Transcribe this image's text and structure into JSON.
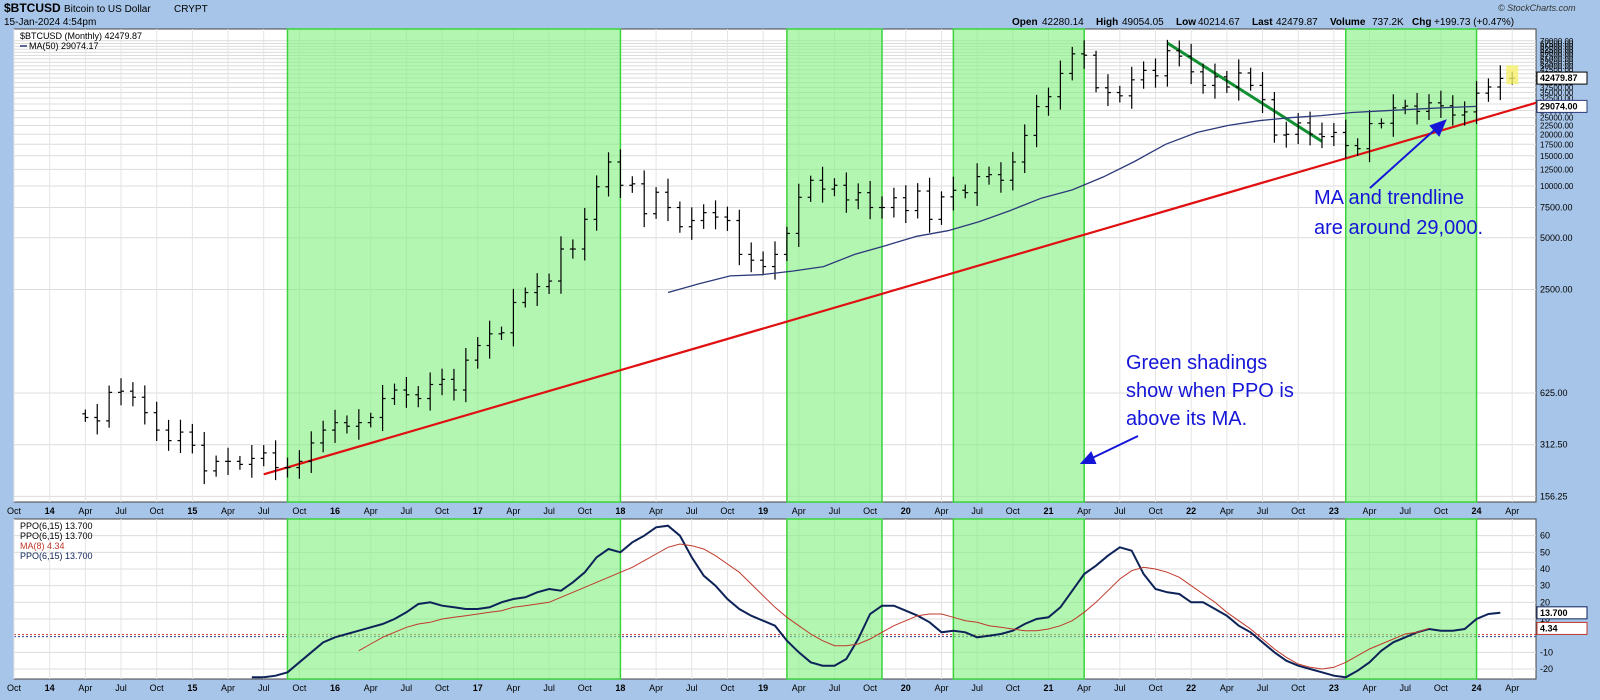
{
  "header": {
    "symbol": "$BTCUSD",
    "name": "Bitcoin to US Dollar",
    "exchange": "CRYPT",
    "date": "15-Jan-2024 4:54pm",
    "open_label": "Open",
    "open": "42280.14",
    "high_label": "High",
    "high": "49054.05",
    "low_label": "Low",
    "low": "40214.67",
    "last_label": "Last",
    "last": "42479.87",
    "volume_label": "Volume",
    "volume": "737.2K",
    "chg_label": "Chg",
    "chg": "+199.73 (+0.47%)",
    "brand": "© StockCharts.com"
  },
  "legend": {
    "price": "$BTCUSD (Monthly) 42479.87",
    "ma": "MA(50) 29074.17",
    "ppo_title": "PPO(6,15) 13.700",
    "ppo_line": "PPO(6,15) 13.700",
    "ppo_ma": "MA(8) 4.34",
    "ppo_line2": "PPO(6,15) 13.700"
  },
  "colors": {
    "price": "#000000",
    "ma50": "#2c3a7a",
    "ppo": "#0d2358",
    "ppo_ma": "#c0392b",
    "trendline": "#e01010",
    "downtrend": "#109030",
    "shading": "#7ff07f",
    "annotation": "#1515d8"
  },
  "annotations": {
    "ma_note": [
      "MA and trendline",
      "are around 29,000."
    ],
    "shade_note": [
      "Green shadings",
      "show when PPO is",
      "above its MA."
    ]
  },
  "chart_data": [
    {
      "type": "ohlc",
      "title": "$BTCUSD (Monthly)",
      "y_scale": "log",
      "ylim": [
        145,
        82000
      ],
      "y_ticks": [
        156.25,
        312.5,
        625,
        2500,
        5000,
        7500,
        10000,
        12500,
        15000,
        17500,
        20000,
        22500,
        25000,
        27500,
        30000,
        32500,
        35000,
        37500,
        40000,
        42500,
        45000,
        47500,
        50000,
        52500,
        55000,
        57500,
        60000,
        62500,
        65000,
        67500,
        70000
      ],
      "y_tick_labels": [
        "156.25",
        "312.50",
        "625.00",
        "2500.00",
        "5000.00",
        "7500.00",
        "10000.00",
        "12500.00",
        "15000.00",
        "17500.00",
        "20000.00",
        "22500.00",
        "25000.00",
        "27500.00",
        "30000.00",
        "32500.00",
        "35000.00",
        "37500.00",
        "40000.00",
        "42500.00",
        "45000.00",
        "47500.00",
        "50000.00",
        "52500.00",
        "55000.00",
        "57500.00",
        "60000.00",
        "62500.00",
        "65000.00",
        "67500.00",
        "70000.00"
      ],
      "x_range": [
        "2013-10",
        "2024-06"
      ],
      "x_tick_labels": [
        "Oct",
        "14",
        "Apr",
        "Jul",
        "Oct",
        "15",
        "Apr",
        "Jul",
        "Oct",
        "16",
        "Apr",
        "Jul",
        "Oct",
        "17",
        "Apr",
        "Jul",
        "Oct",
        "18",
        "Apr",
        "Jul",
        "Oct",
        "19",
        "Apr",
        "Jul",
        "Oct",
        "20",
        "Apr",
        "Jul",
        "Oct",
        "21",
        "Apr",
        "Jul",
        "Oct",
        "22",
        "Apr",
        "Jul",
        "Oct",
        "23",
        "Apr",
        "Jul",
        "Oct",
        "24",
        "Apr"
      ],
      "first_month": "2014-04",
      "closes": [
        450,
        430,
        630,
        640,
        590,
        480,
        380,
        330,
        370,
        310,
        220,
        250,
        250,
        240,
        260,
        280,
        230,
        230,
        250,
        320,
        380,
        420,
        400,
        420,
        450,
        580,
        650,
        610,
        580,
        700,
        750,
        650,
        970,
        1180,
        1380,
        1400,
        2100,
        2400,
        2600,
        2800,
        4300,
        4300,
        6400,
        9900,
        13800,
        10100,
        10300,
        6900,
        9200,
        7500,
        5800,
        6300,
        7000,
        6600,
        6300,
        4000,
        3700,
        3400,
        4000,
        5300,
        8600,
        10800,
        9600,
        10100,
        8300,
        9150,
        7500,
        7500,
        8550,
        7200,
        9350,
        6400,
        8650,
        9450,
        9150,
        11350,
        11650,
        10800,
        13800,
        19700,
        29000,
        33100,
        45200,
        58800,
        57700,
        37300,
        35000,
        33500,
        41500,
        47100,
        43800,
        61300,
        57000,
        46200,
        38500,
        43200,
        37700,
        45500,
        38500,
        31800,
        19800,
        20000,
        23300,
        20050,
        19400,
        20500,
        17200,
        16500,
        23100,
        23200,
        28500,
        29200,
        27200,
        30500,
        29300,
        25900,
        27000,
        34700,
        37700,
        42300,
        42480
      ],
      "ohlc_reading": "closes estimated from the bar chart; open of each bar is the prior close",
      "moving_average": {
        "name": "MA(50)",
        "start_month": "2018-05",
        "values": [
          2400,
          2700,
          3000,
          3050,
          3200,
          3400,
          4000,
          4500,
          5100,
          5500,
          6200,
          7200,
          8500,
          9500,
          11300,
          13900,
          17500,
          20500,
          22500,
          24000,
          25000,
          25700,
          26800,
          27400,
          28000,
          28600,
          29074
        ]
      },
      "trendline": {
        "from": [
          "2015-07",
          210
        ],
        "to": [
          "2024-06",
          30500
        ]
      },
      "downtrend": {
        "from": [
          "2021-11",
          68000
        ],
        "to": [
          "2022-12",
          18200
        ]
      }
    },
    {
      "type": "line",
      "title": "PPO(6,15)",
      "ylim": [
        -26,
        70
      ],
      "y_ticks": [
        -20,
        -10,
        10,
        20,
        30,
        40,
        50,
        60
      ],
      "zero_line": 0,
      "series": [
        {
          "name": "PPO(6,15)",
          "start_month": "2015-06",
          "values": [
            -25,
            -25,
            -24,
            -22,
            -16,
            -10,
            -4,
            -1,
            1,
            3,
            5,
            7,
            10,
            14,
            19,
            20,
            18,
            17,
            16,
            16,
            17,
            20,
            22,
            23,
            26,
            28,
            27,
            32,
            38,
            47,
            52,
            50,
            56,
            60,
            65,
            66,
            60,
            47,
            36,
            30,
            22,
            16,
            12,
            9,
            6,
            -3,
            -10,
            -16,
            -18,
            -18,
            -14,
            -2,
            13,
            18,
            18,
            15,
            12,
            8,
            2,
            3,
            2,
            -1,
            0,
            1,
            3,
            7,
            10,
            11,
            17,
            27,
            37,
            42,
            48,
            53,
            51,
            37,
            28,
            26,
            25,
            20,
            20,
            16,
            12,
            6,
            2,
            -4,
            -10,
            -15,
            -18,
            -20,
            -22,
            -24,
            -25,
            -21,
            -16,
            -9,
            -4,
            -1,
            2,
            4,
            3,
            3,
            4,
            10,
            13,
            13.7
          ]
        },
        {
          "name": "MA(8)",
          "start_month": "2016-03",
          "values": [
            -9,
            -5,
            -1,
            2,
            5,
            7,
            8,
            10,
            11,
            12,
            13,
            14,
            15,
            17,
            18,
            19,
            20,
            23,
            26,
            29,
            32,
            35,
            38,
            41,
            45,
            49,
            53,
            55,
            54,
            52,
            48,
            43,
            38,
            31,
            24,
            17,
            11,
            6,
            1,
            -3,
            -6,
            -6,
            -5,
            -2,
            2,
            6,
            9,
            12,
            13,
            13,
            11,
            9,
            8,
            6,
            5,
            4,
            3,
            3,
            4,
            6,
            9,
            14,
            20,
            27,
            34,
            39,
            41,
            40,
            38,
            35,
            30,
            25,
            20,
            14,
            9,
            4,
            -2,
            -8,
            -13,
            -17,
            -19,
            -20,
            -19,
            -16,
            -12,
            -8,
            -5,
            -2,
            1,
            2,
            4.34
          ]
        }
      ]
    }
  ],
  "green_shading": [
    {
      "from": "2015-09",
      "to": "2018-01"
    },
    {
      "from": "2019-03",
      "to": "2019-11"
    },
    {
      "from": "2020-05",
      "to": "2021-04"
    },
    {
      "from": "2023-02",
      "to": "2024-01"
    }
  ]
}
